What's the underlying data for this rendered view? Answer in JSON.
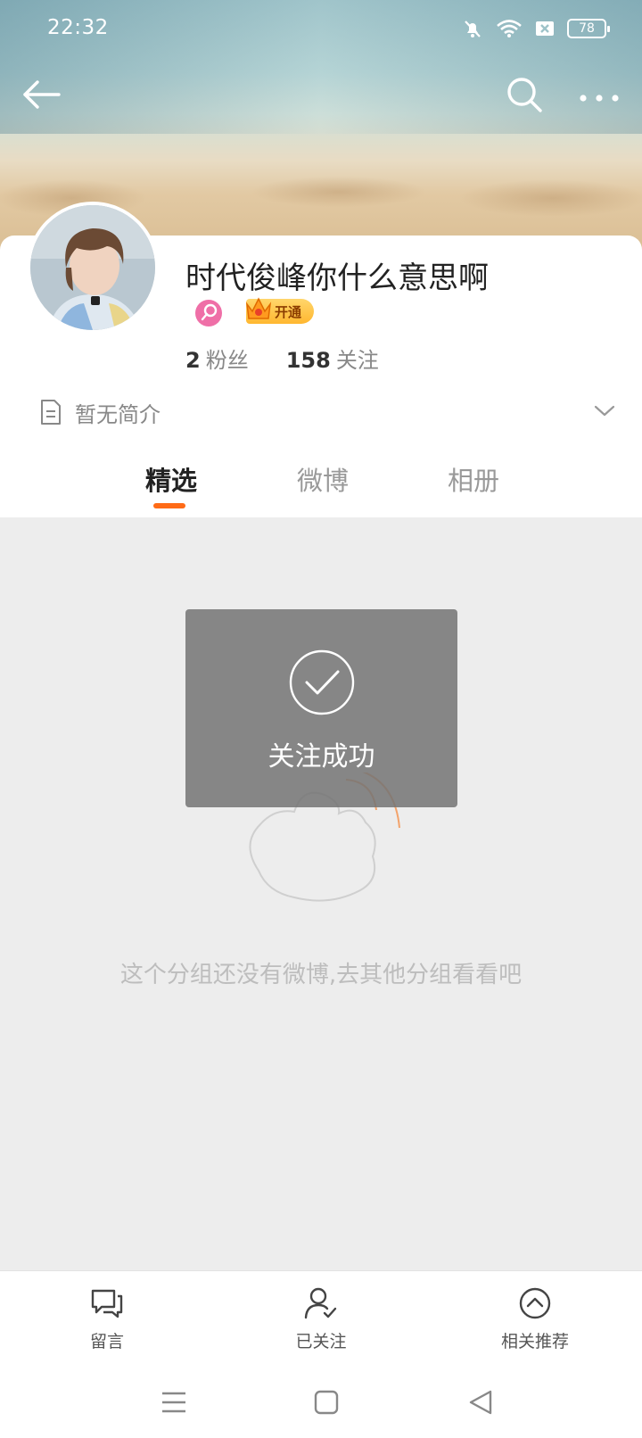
{
  "status_bar": {
    "time": "22:32",
    "battery": "78"
  },
  "profile": {
    "name": "时代俊峰你什么意思啊",
    "vip_label": "开通",
    "followers_count": "2",
    "followers_label": "粉丝",
    "following_count": "158",
    "following_label": "关注",
    "bio": "暂无简介"
  },
  "tabs": [
    {
      "label": "精选"
    },
    {
      "label": "微博"
    },
    {
      "label": "相册"
    }
  ],
  "toast": {
    "text": "关注成功"
  },
  "empty_state": {
    "text": "这个分组还没有微博,去其他分组看看吧"
  },
  "bottom_actions": [
    {
      "label": "留言",
      "icon": "message-icon"
    },
    {
      "label": "已关注",
      "icon": "user-followed-icon"
    },
    {
      "label": "相关推荐",
      "icon": "chevron-up-circle-icon"
    }
  ],
  "colors": {
    "accent": "#ff6b17",
    "toast_bg": "#747474",
    "page_bg": "#ededed"
  }
}
